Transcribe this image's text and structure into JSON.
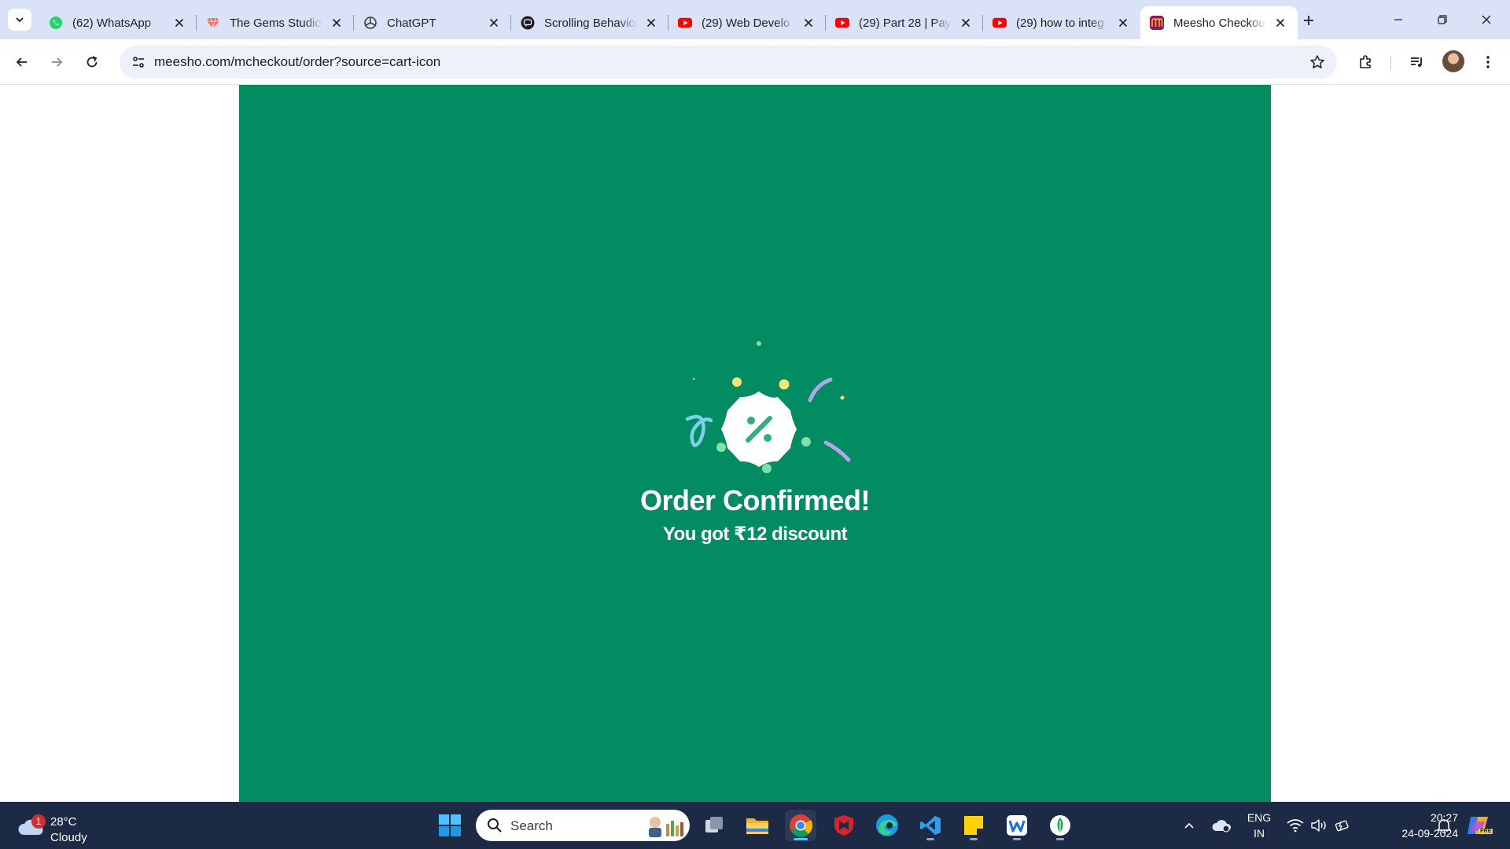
{
  "browser": {
    "tabs": [
      {
        "title": "(62) WhatsApp",
        "icon": "whatsapp-icon",
        "color": "#25d366",
        "active": false
      },
      {
        "title": "The Gems Studio",
        "icon": "gem-icon",
        "color": "#f06a5a",
        "active": false
      },
      {
        "title": "ChatGPT",
        "icon": "chatgpt-icon",
        "color": "#3c3c3c",
        "active": false
      },
      {
        "title": "Scrolling Behavior",
        "icon": "chat-bubble-icon",
        "color": "#1f1f1f",
        "active": false
      },
      {
        "title": "(29) Web Develo",
        "icon": "youtube-icon",
        "color": "#ff0000",
        "active": false
      },
      {
        "title": "(29) Part 28 | Pay",
        "icon": "youtube-icon",
        "color": "#ff0000",
        "active": false
      },
      {
        "title": "(29) how to integ",
        "icon": "youtube-icon",
        "color": "#ff0000",
        "active": false
      },
      {
        "title": "Meesho Checkout",
        "icon": "meesho-icon",
        "color": "#8b1a4a",
        "active": true
      }
    ],
    "url": "meesho.com/mcheckout/order?source=cart-icon"
  },
  "page": {
    "background_color": "#038b61",
    "title": "Order Confirmed!",
    "subtitle": "You got ₹12 discount"
  },
  "taskbar": {
    "weather_temp": "28°C",
    "weather_condition": "Cloudy",
    "weather_badge": "1",
    "search_label": "Search",
    "language_top": "ENG",
    "language_bottom": "IN",
    "time": "20:27",
    "date": "24-09-2024",
    "copilot_badge": "PRE"
  }
}
